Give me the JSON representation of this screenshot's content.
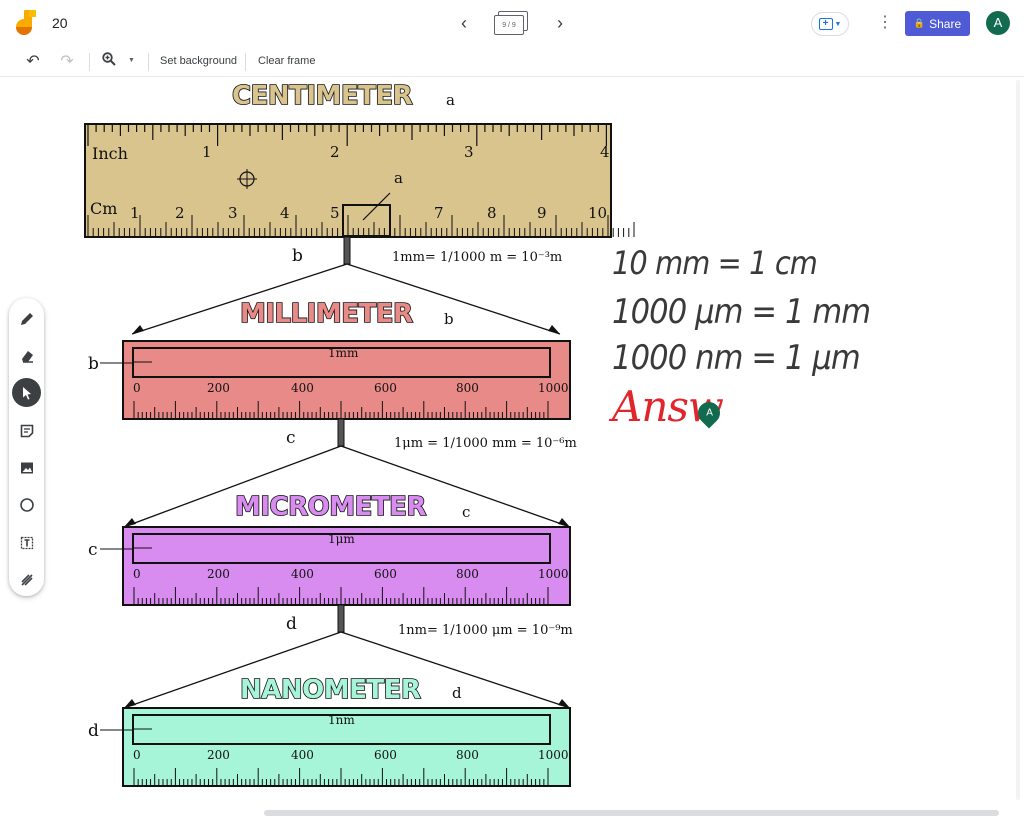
{
  "header": {
    "frame_number": "20",
    "frame_counter": "9 / 9",
    "share_label": "Share",
    "avatar_initial": "A"
  },
  "toolbar": {
    "set_background": "Set background",
    "clear_frame": "Clear frame"
  },
  "tools": [
    {
      "name": "pen-tool",
      "icon": "pen-icon"
    },
    {
      "name": "eraser-tool",
      "icon": "eraser-icon"
    },
    {
      "name": "select-tool",
      "icon": "pointer-icon",
      "active": true
    },
    {
      "name": "sticky-note-tool",
      "icon": "sticky-note-icon"
    },
    {
      "name": "add-image-tool",
      "icon": "image-icon"
    },
    {
      "name": "circle-tool",
      "icon": "circle-icon"
    },
    {
      "name": "text-box-tool",
      "icon": "text-box-icon"
    },
    {
      "name": "laser-tool",
      "icon": "laser-icon"
    }
  ],
  "diagram": {
    "centimeter": {
      "title": "CENTIMETER",
      "marker": "a",
      "inch_label": "Inch",
      "cm_label": "Cm",
      "inch_ticks": [
        "1",
        "2",
        "3",
        "4"
      ],
      "cm_ticks": [
        "1",
        "2",
        "3",
        "4",
        "5",
        "7",
        "8",
        "9",
        "10"
      ],
      "equation": "1mm= 1/1000 m = 10⁻³m"
    },
    "millimeter": {
      "title": "MILLIMETER",
      "marker": "b",
      "unit": "1mm",
      "ticks": [
        "0",
        "200",
        "400",
        "600",
        "800",
        "1000"
      ],
      "equation": "1μm = 1/1000 mm = 10⁻⁶m"
    },
    "micrometer": {
      "title": "MICROMETER",
      "marker": "c",
      "unit": "1μm",
      "ticks": [
        "0",
        "200",
        "400",
        "600",
        "800",
        "1000"
      ],
      "equation": "1nm= 1/1000 μm = 10⁻⁹m"
    },
    "nanometer": {
      "title": "NANOMETER",
      "marker": "d",
      "unit": "1nm",
      "ticks": [
        "0",
        "200",
        "400",
        "600",
        "800",
        "1000"
      ]
    }
  },
  "notes": {
    "line1": "10 mm = 1 cm",
    "line2": "1000 μm = 1 mm",
    "line3": "1000 nm = 1 μm",
    "answer": "Answ",
    "collaborator_initial": "A"
  },
  "colors": {
    "centimeter_ruler": "#d9c48e",
    "millimeter_ruler": "#e88a87",
    "micrometer_ruler": "#d98cf0",
    "nanometer_ruler": "#a7f5d8",
    "brand": "#4f5bd5",
    "answer": "#e0252b"
  }
}
